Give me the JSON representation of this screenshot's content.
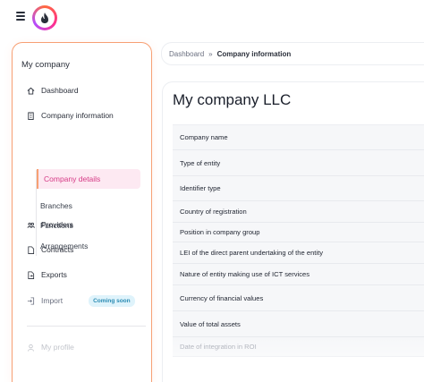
{
  "header": {
    "menu_icon": "hamburger-icon",
    "logo_icon": "flame-logo-icon"
  },
  "sidebar": {
    "title": "My company",
    "items": [
      {
        "label": "Dashboard",
        "icon": "home-icon"
      },
      {
        "label": "Company information",
        "icon": "building-icon"
      },
      {
        "label": "Providers",
        "icon": "users-icon"
      },
      {
        "label": "Contracts",
        "icon": "document-icon"
      },
      {
        "label": "Exports",
        "icon": "export-icon"
      },
      {
        "label": "Import",
        "icon": "import-icon",
        "badge": "Coming soon"
      },
      {
        "label": "My profile",
        "icon": "user-icon"
      }
    ],
    "sub_items": [
      {
        "label": "Company details",
        "active": true
      },
      {
        "label": "Branches"
      },
      {
        "label": "Functions"
      },
      {
        "label": "Arrangements"
      }
    ]
  },
  "breadcrumb": {
    "root": "Dashboard",
    "separator": "»",
    "current": "Company information"
  },
  "main": {
    "title": "My company LLC",
    "rows": [
      "Company name",
      "Type of entity",
      "Identifier type",
      "Country of registration",
      "Position in company group",
      "LEI of the direct parent undertaking of the entity",
      "Nature of entity making use of ICT services",
      "Currency of financial values",
      "Value of total assets",
      "Date of integration in ROI"
    ]
  },
  "colors": {
    "accent_orange": "#f7a074",
    "active_pink": "#d63a86",
    "active_bg": "#fde9f2",
    "badge_bg": "#dff3fb",
    "badge_text": "#2a8bb3"
  }
}
